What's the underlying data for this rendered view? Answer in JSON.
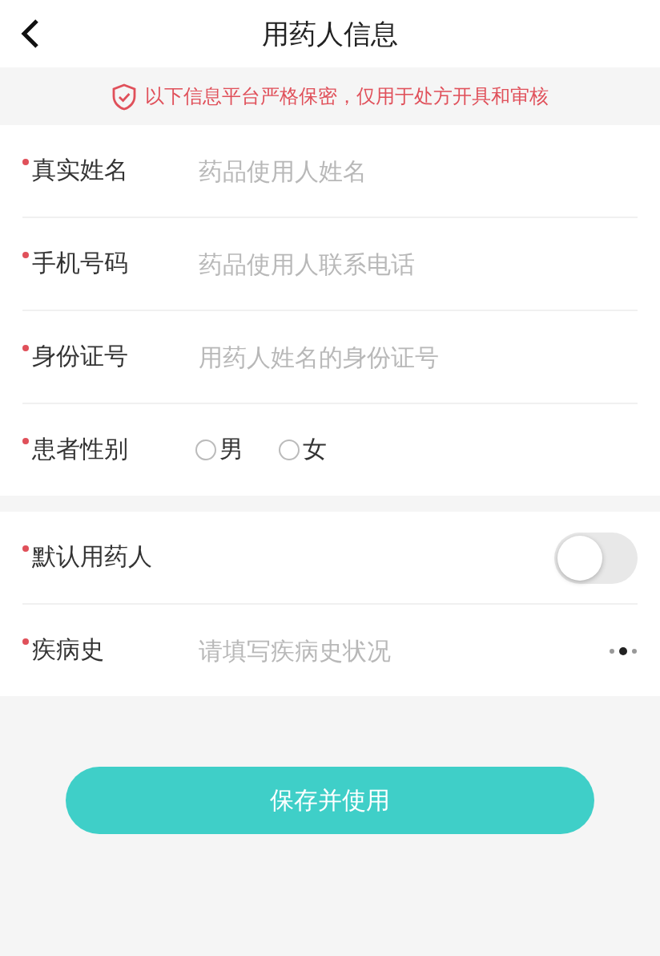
{
  "header": {
    "title": "用药人信息"
  },
  "notice": {
    "text": "以下信息平台严格保密，仅用于处方开具和审核"
  },
  "groups": [
    {
      "fields": [
        {
          "kind": "input",
          "label": "真实姓名",
          "required": true,
          "placeholder": "药品使用人姓名"
        },
        {
          "kind": "input",
          "label": "手机号码",
          "required": true,
          "placeholder": "药品使用人联系电话"
        },
        {
          "kind": "input",
          "label": "身份证号",
          "required": true,
          "placeholder": "用药人姓名的身份证号"
        },
        {
          "kind": "radio",
          "label": "患者性别",
          "required": true,
          "options": [
            {
              "label": "男",
              "selected": false
            },
            {
              "label": "女",
              "selected": false
            }
          ]
        }
      ]
    },
    {
      "fields": [
        {
          "kind": "switch",
          "label": "默认用药人",
          "required": true,
          "on": false
        },
        {
          "kind": "picker",
          "label": "疾病史",
          "required": true,
          "placeholder": "请填写疾病史状况"
        }
      ]
    }
  ],
  "save_button": {
    "label": "保存并使用"
  }
}
